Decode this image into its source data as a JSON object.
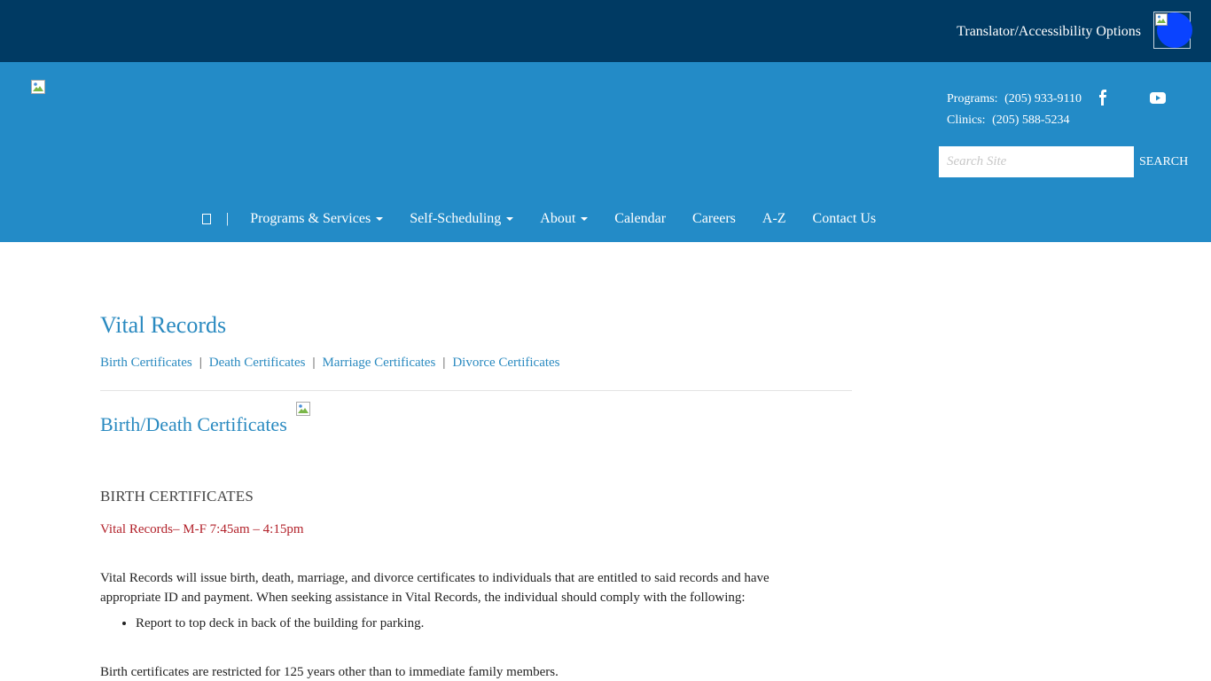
{
  "topbar": {
    "translator_label": "Translator/Accessibility Options"
  },
  "header": {
    "programs_label": "Programs:",
    "programs_phone": "(205) 933-9110",
    "clinics_label": "Clinics:",
    "clinics_phone": "(205) 588-5234",
    "search_placeholder": "Search Site",
    "search_button": "SEARCH"
  },
  "nav": {
    "home_icon": "home-icon",
    "separator": "|",
    "items": [
      {
        "label": "Programs & Services",
        "dropdown": true
      },
      {
        "label": "Self-Scheduling",
        "dropdown": true
      },
      {
        "label": "About",
        "dropdown": true
      },
      {
        "label": "Calendar",
        "dropdown": false
      },
      {
        "label": "Careers",
        "dropdown": false
      },
      {
        "label": "A-Z",
        "dropdown": false
      },
      {
        "label": "Contact Us",
        "dropdown": false
      }
    ]
  },
  "content": {
    "page_title": "Vital Records",
    "sub_links": [
      "Birth Certificates",
      "Death Certificates",
      "Marriage Certificates",
      "Divorce Certificates"
    ],
    "section_title": "Birth/Death Certificates",
    "birth_heading": "BIRTH CERTIFICATES",
    "hours": "Vital Records– M-F 7:45am – 4:15pm",
    "paragraph": "Vital Records will issue birth, death, marriage, and divorce certificates to individuals that are entitled to said records and have appropriate ID and payment. When seeking assistance in Vital Records, the individual should comply with the following:",
    "bullets": [
      "Report to top deck in back of the building for parking."
    ],
    "restricted": "Birth certificates are restricted for 125 years other than to immediate family members."
  },
  "colors": {
    "topbar_bg": "#003a63",
    "header_bg": "#238bc7",
    "link": "#2a8ac0",
    "hours_red": "#b2212a",
    "a11y_blue": "#0a43ff"
  }
}
